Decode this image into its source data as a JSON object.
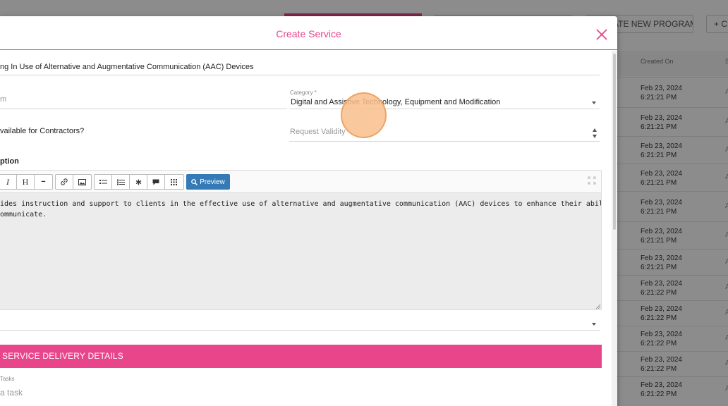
{
  "background": {
    "top_buttons": [
      "ATE NEW PROGRAM",
      "+ CR"
    ],
    "columns": {
      "created_on": "Created On",
      "s": "S"
    },
    "rows": [
      {
        "date": "Feb 23, 2024",
        "time": "6:21:21 PM",
        "s": "A"
      },
      {
        "date": "Feb 23, 2024",
        "time": "6:21:21 PM",
        "s": "A"
      },
      {
        "date": "Feb 23, 2024",
        "time": "6:21:21 PM",
        "s": "A"
      },
      {
        "date": "Feb 23, 2024",
        "time": "6:21:21 PM",
        "s": "A"
      },
      {
        "date": "Feb 23, 2024",
        "time": "6:21:21 PM",
        "s": "A"
      },
      {
        "date": "Feb 23, 2024",
        "time": "6:21:21 PM",
        "s": "A"
      },
      {
        "date": "Feb 23, 2024",
        "time": "6:21:21 PM",
        "s": "A"
      },
      {
        "date": "Feb 23, 2024",
        "time": "6:21:22 PM",
        "s": "A"
      },
      {
        "date": "Feb 23, 2024",
        "time": "6:21:22 PM",
        "s": "A"
      },
      {
        "date": "Feb 23, 2024",
        "time": "6:21:22 PM",
        "s": "A"
      },
      {
        "date": "Feb 23, 2024",
        "time": "6:21:22 PM",
        "s": "A"
      },
      {
        "date": "Feb 23, 2024",
        "time": "6:21:22 PM",
        "s": "A"
      }
    ]
  },
  "modal": {
    "title": "Create Service",
    "service_name": "ng In Use of Alternative and Augmentative Communication (AAC) Devices",
    "left_field_placeholder": "m",
    "category": {
      "label": "Category *",
      "value": "Digital and Assistive Technology, Equipment and Modification"
    },
    "contractors_label": "vailable for Contractors?",
    "request_validity_placeholder": "Request Validity",
    "description_label": "ption",
    "toolbar": {
      "italic": "I",
      "heading": "H",
      "hr": "−",
      "preview_label": "Preview"
    },
    "description_lines": [
      "ides instruction and support to clients in the effective use of alternative and augmentative communication (AAC) devices to enhance their ability",
      "ommunicate."
    ],
    "service_delivery_title": "SERVICE DELIVERY DETAILS",
    "tasks_label": "Tasks",
    "task_placeholder": "a task"
  },
  "colors": {
    "accent": "#e8458b",
    "preview_button": "#337ab7"
  }
}
